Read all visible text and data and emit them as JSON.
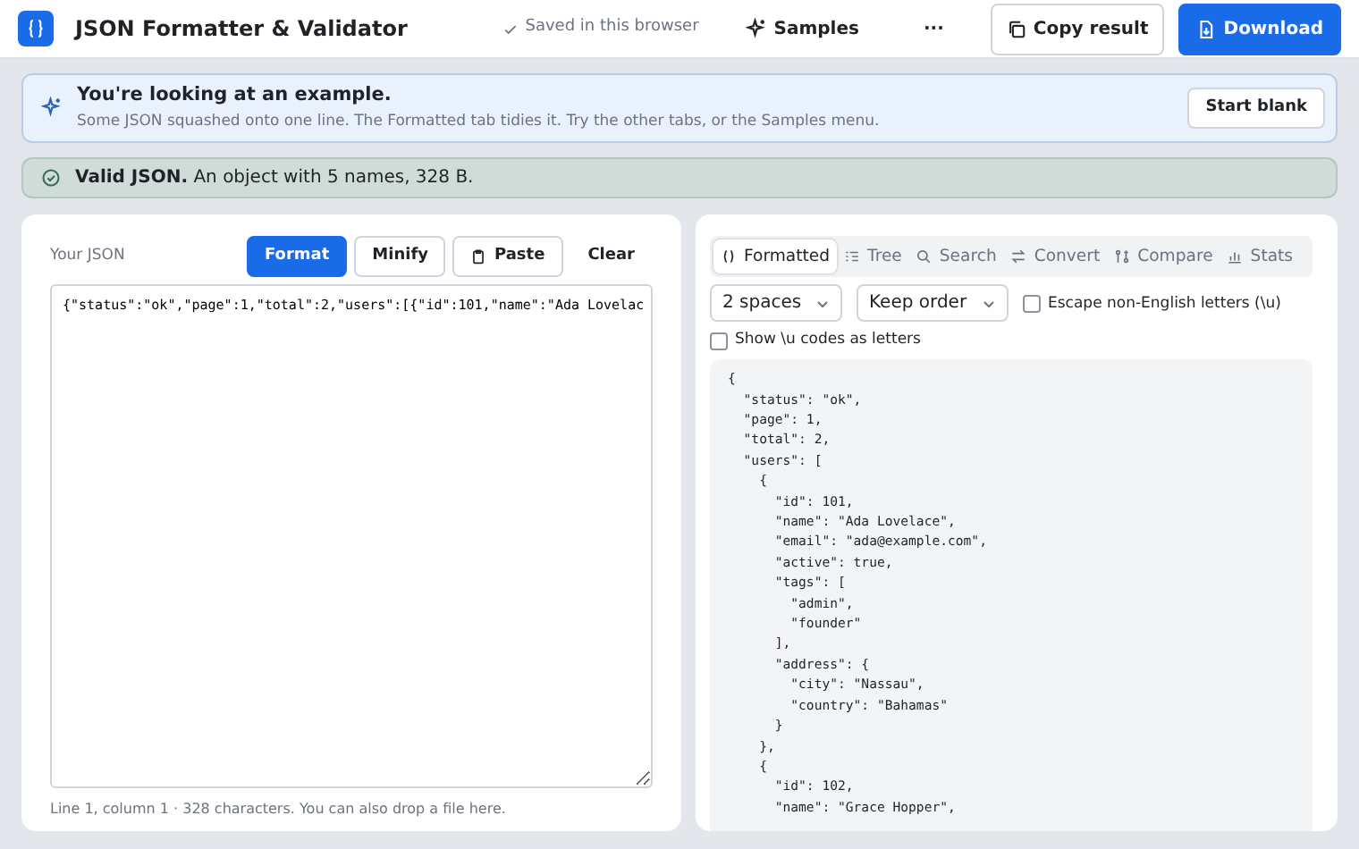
{
  "app": {
    "title": "JSON Formatter & Validator",
    "saved": "Saved in this browser",
    "samples": "Samples",
    "more": "···",
    "copy": "Copy result",
    "download": "Download"
  },
  "notice": {
    "title": "You're looking at an example.",
    "text": "Some JSON squashed onto one line. The Formatted tab tidies it. Try the other tabs, or the Samples menu.",
    "button": "Start blank"
  },
  "status": {
    "valid": true,
    "bold": "Valid JSON.",
    "text": "An object with 5 names, 328 B."
  },
  "input": {
    "label": "Your JSON",
    "buttons": [
      {
        "label": "Format",
        "primary": true
      },
      {
        "label": "Minify",
        "primary": false
      },
      {
        "label": "Paste",
        "primary": false
      },
      {
        "label": "Clear",
        "primary": false
      }
    ],
    "value": "{\"status\":\"ok\",\"page\":1,\"total\":2,\"users\":[{\"id\":101,\"name\":\"Ada Lovelac",
    "footer": "Line 1, column 1 · 328 characters. You can also drop a file here."
  },
  "output": {
    "tabs": [
      {
        "label": "Formatted",
        "selected": true
      },
      {
        "label": "Tree",
        "selected": false
      },
      {
        "label": "Search",
        "selected": false
      },
      {
        "label": "Convert",
        "selected": false
      },
      {
        "label": "Compare",
        "selected": false
      },
      {
        "label": "Stats",
        "selected": false
      }
    ],
    "selects": [
      "2 spaces",
      "Keep order"
    ],
    "options": [
      {
        "label": "Escape non-English letters (\\u)",
        "checked": false
      },
      {
        "label": "Show \\u codes as letters",
        "checked": false
      }
    ],
    "lines": [
      "{",
      "  \"status\": \"ok\",",
      "  \"page\": 1,",
      "  \"total\": 2,",
      "  \"users\": [",
      "    {",
      "      \"id\": 101,",
      "      \"name\": \"Ada Lovelace\",",
      "      \"email\": \"ada@example.com\",",
      "      \"active\": true,",
      "      \"tags\": [",
      "        \"admin\",",
      "        \"founder\"",
      "      ],",
      "      \"address\": {",
      "        \"city\": \"Nassau\",",
      "        \"country\": \"Bahamas\"",
      "      }",
      "    },",
      "    {",
      "      \"id\": 102,",
      "      \"name\": \"Grace Hopper\","
    ]
  }
}
